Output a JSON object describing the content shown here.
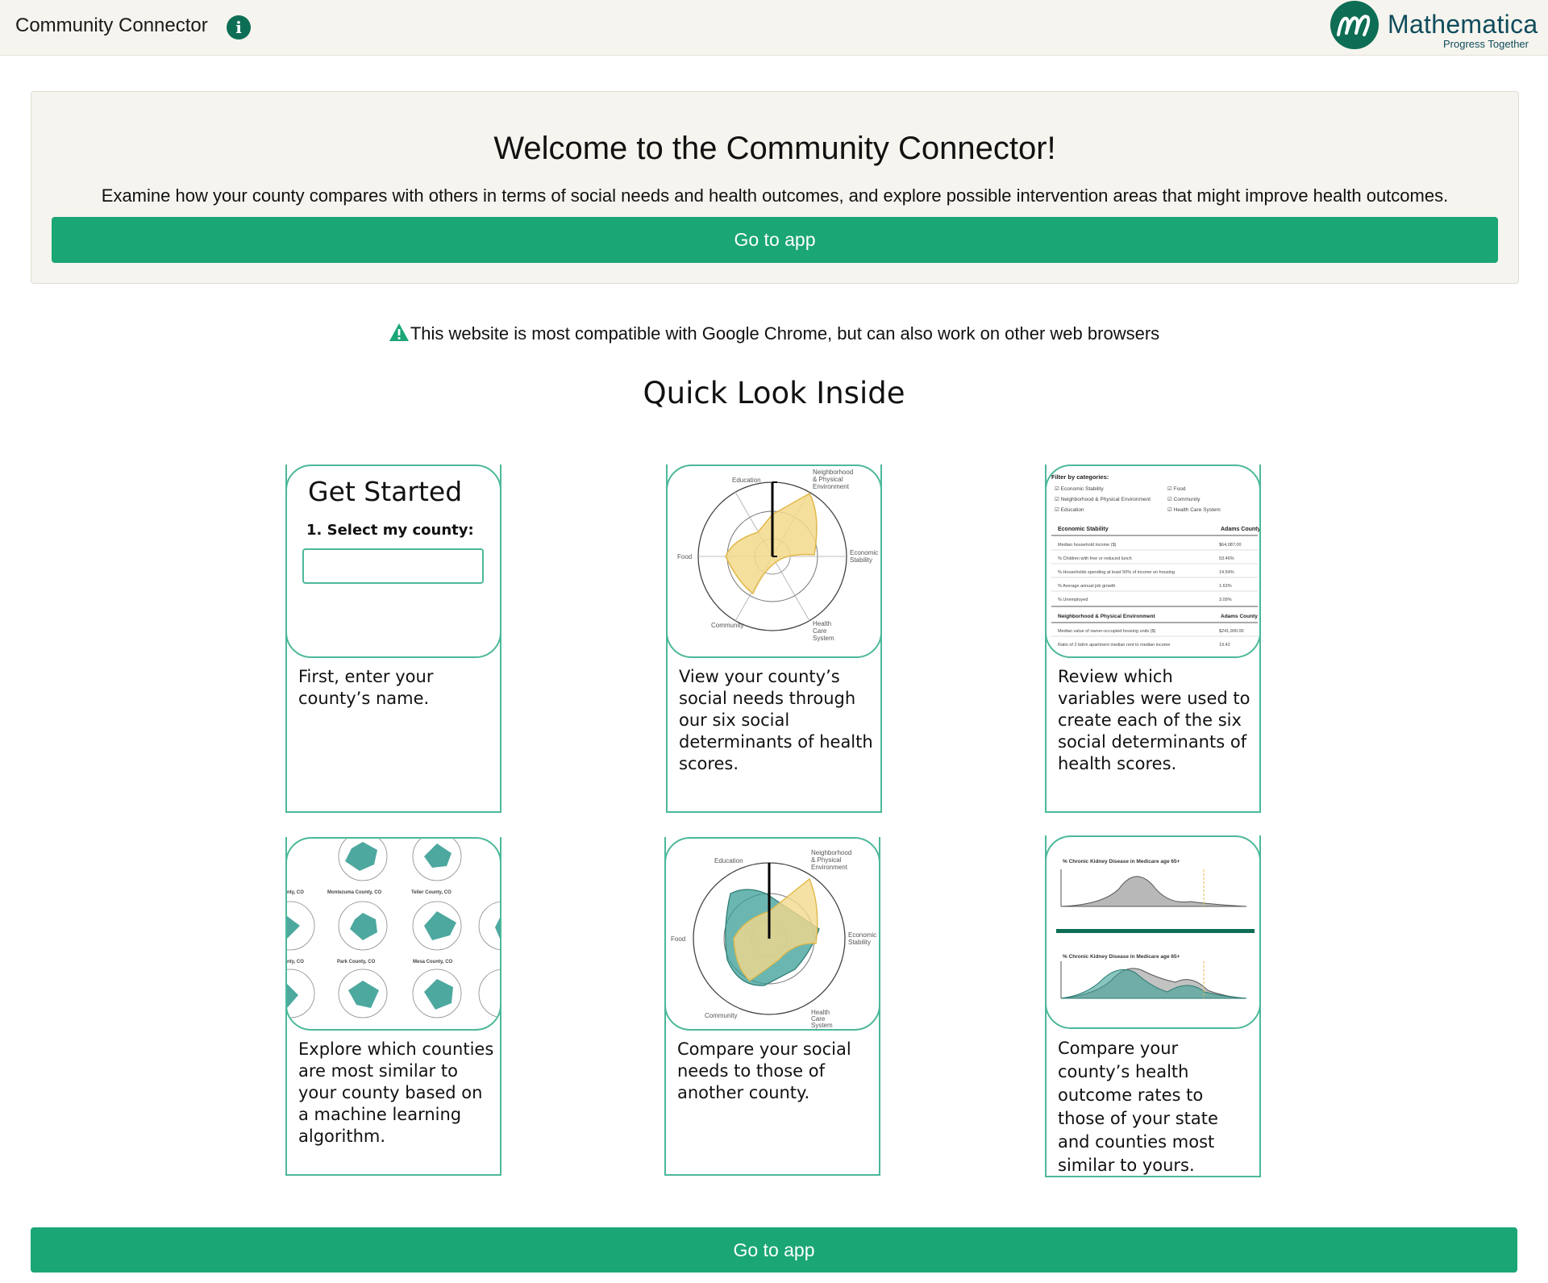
{
  "header": {
    "app_title": "Community Connector",
    "info_icon": "info-icon",
    "logo_name": "Mathematica",
    "logo_tagline": "Progress Together"
  },
  "welcome": {
    "title": "Welcome to the Community Connector!",
    "description": "Examine how your county compares with others in terms of social needs and health outcomes, and explore possible intervention areas that might improve health outcomes.",
    "button_label": "Go to app"
  },
  "compat_notice": {
    "icon": "warning-triangle-icon",
    "text": "This website is most compatible with Google Chrome, but can also work on other web browsers"
  },
  "section_title": "Quick Look Inside",
  "cards": [
    {
      "thumb_title": "Get Started",
      "thumb_label": "1. Select my county:",
      "caption": "First, enter your county’s name."
    },
    {
      "caption": "View your county’s social needs through our six social determinants of health scores.",
      "radar_labels": [
        "Education",
        "Neighborhood & Physical Environment",
        "Economic Stability",
        "Health Care System",
        "Community",
        "Food"
      ],
      "scale_ticks": [
        "1",
        "0.5",
        "0"
      ]
    },
    {
      "caption": "Review which variables were used to create each of the six social determinants of health scores.",
      "filter_title": "Filter by categories:",
      "filters": [
        "Economic Stability",
        "Food",
        "Neighborhood & Physical Environment",
        "Community",
        "Education",
        "Health Care System"
      ],
      "table1": {
        "header": "Economic Stability",
        "column": "Adams County",
        "rows": [
          [
            "Median household income ($)",
            "$64,087.00"
          ],
          [
            "% Children with free or reduced lunch",
            "53.46%"
          ],
          [
            "% Households spending at least 50% of income on housing",
            "14.54%"
          ],
          [
            "% Average annual job growth",
            "1.63%"
          ],
          [
            "% Unemployed",
            "3.09%"
          ]
        ]
      },
      "table2": {
        "header": "Neighborhood & Physical Environment",
        "column": "Adams County",
        "rows": [
          [
            "Median value of owner-occupied housing units ($)",
            "$241,900.00"
          ],
          [
            "Ratio of 2 bdrm apartment median rent to median income",
            "19.42"
          ]
        ]
      }
    },
    {
      "caption": "Explore which counties are most similar to your county based on a machine learning algorithm.",
      "county_labels": [
        "Montezuma County, CO",
        "Teller County, CO",
        "Park County, CO",
        "Mesa County, CO"
      ]
    },
    {
      "caption": "Compare your social needs to those of another county.",
      "radar_labels": [
        "Education",
        "Neighborhood & Physical Environment",
        "Economic Stability",
        "Health Care System",
        "Community",
        "Food"
      ]
    },
    {
      "caption": "Compare your county’s health outcome rates to those of your state and counties most similar to yours.",
      "plot_title": "% Chronic Kidney Disease in Medicare age 65+"
    }
  ],
  "bottom_button_label": "Go to app",
  "colors": {
    "accent": "#1aa675",
    "brand": "#0e6e55",
    "card_border": "#4cb89a",
    "radar_yellow": "#f3d98c",
    "radar_teal": "#3a9e95"
  }
}
